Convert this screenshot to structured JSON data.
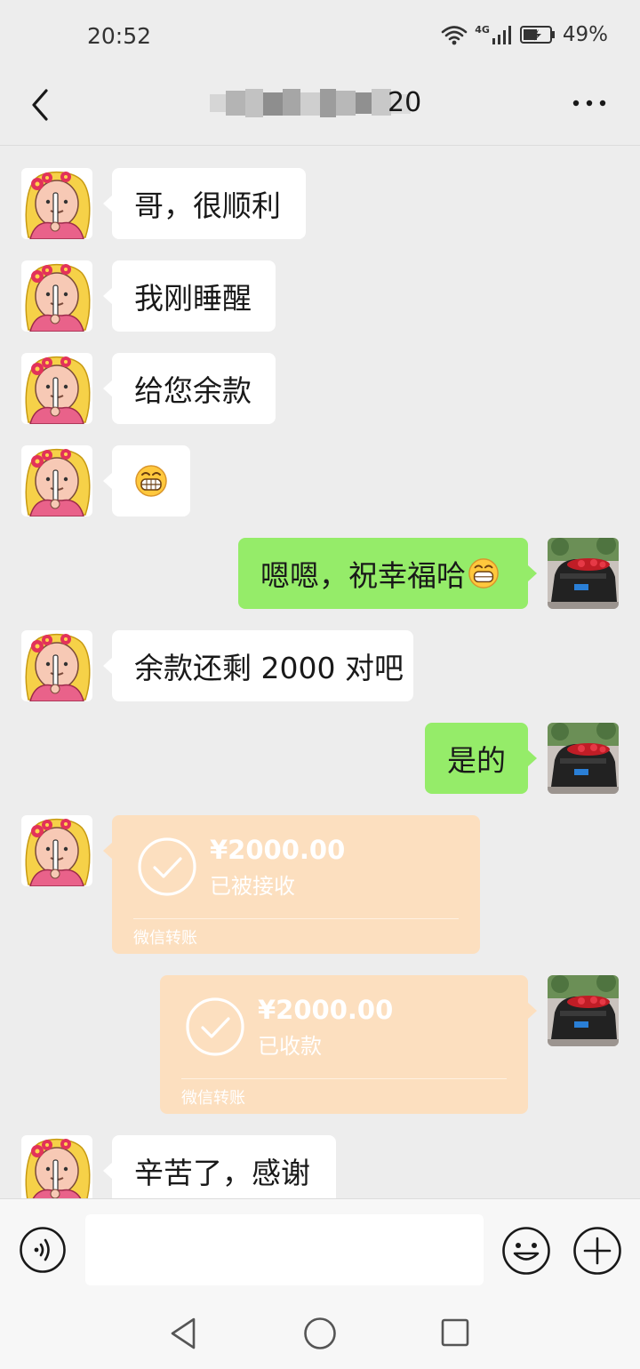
{
  "status_bar": {
    "time": "20:52",
    "network": "4G",
    "battery": "49%"
  },
  "header": {
    "title": "20"
  },
  "messages": [
    {
      "text": "哥，很顺利"
    },
    {
      "text": "我刚睡醒"
    },
    {
      "text": "给您余款"
    },
    {
      "emoji": "grinning-face"
    },
    {
      "text": "嗯嗯，祝幸福哈"
    },
    {
      "text": "余款还剩 2000 对吧"
    },
    {
      "text": "是的"
    },
    {
      "text": "辛苦了，感谢"
    }
  ],
  "transfers": [
    {
      "amount": "¥2000.00",
      "status": "已被接收",
      "label": "微信转账"
    },
    {
      "amount": "¥2000.00",
      "status": "已收款",
      "label": "微信转账"
    }
  ],
  "input": {
    "placeholder": ""
  },
  "colors": {
    "outgoing_bubble": "#95ec69",
    "incoming_bubble": "#ffffff",
    "transfer_card": "#fcdfbf",
    "background": "#ededed"
  }
}
